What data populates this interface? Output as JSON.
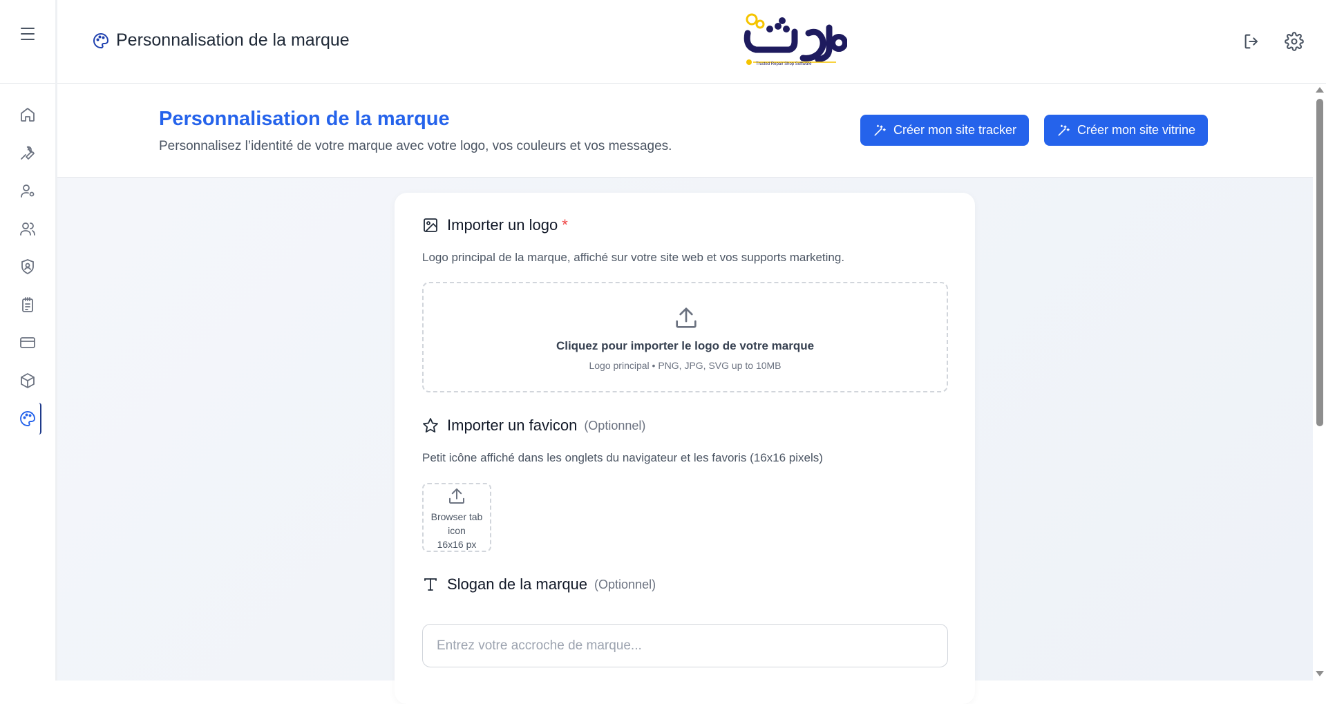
{
  "header": {
    "title": "Personnalisation de la marque",
    "logo_text": "ورشة",
    "logo_tagline": "Trusted Repair Shop Software"
  },
  "sidebar": {
    "items": [
      {
        "icon": "home-icon"
      },
      {
        "icon": "wrench-icon"
      },
      {
        "icon": "user-settings-icon"
      },
      {
        "icon": "users-icon"
      },
      {
        "icon": "shield-user-icon"
      },
      {
        "icon": "clipboard-icon"
      },
      {
        "icon": "credit-card-icon"
      },
      {
        "icon": "box-icon"
      },
      {
        "icon": "palette-icon",
        "active": true
      }
    ]
  },
  "page": {
    "title": "Personnalisation de la marque",
    "subtitle": "Personnalisez l’identité de votre marque avec votre logo, vos couleurs et vos messages.",
    "buttons": {
      "tracker": "Créer mon site tracker",
      "vitrine": "Créer mon site vitrine"
    }
  },
  "logo_section": {
    "title": "Importer un logo",
    "required_mark": "*",
    "description": "Logo principal de la marque, affiché sur votre site web et vos supports marketing.",
    "dropzone_title": "Cliquez pour importer le logo de votre marque",
    "dropzone_hint": "Logo principal • PNG, JPG, SVG up to 10MB"
  },
  "favicon_section": {
    "title": "Importer un favicon",
    "optional": "(Optionnel)",
    "description": "Petit icône affiché dans les onglets du navigateur et les favoris (16x16 pixels)",
    "box_line1": "Browser tab",
    "box_line2": "icon",
    "box_line3": "16x16 px"
  },
  "slogan_section": {
    "title": "Slogan de la marque",
    "optional": "(Optionnel)",
    "placeholder": "Entrez votre accroche de marque..."
  },
  "colors": {
    "primary": "#2563eb",
    "logo_navy": "#1e1b5e",
    "logo_yellow": "#f5c400",
    "required": "#ef4444"
  }
}
